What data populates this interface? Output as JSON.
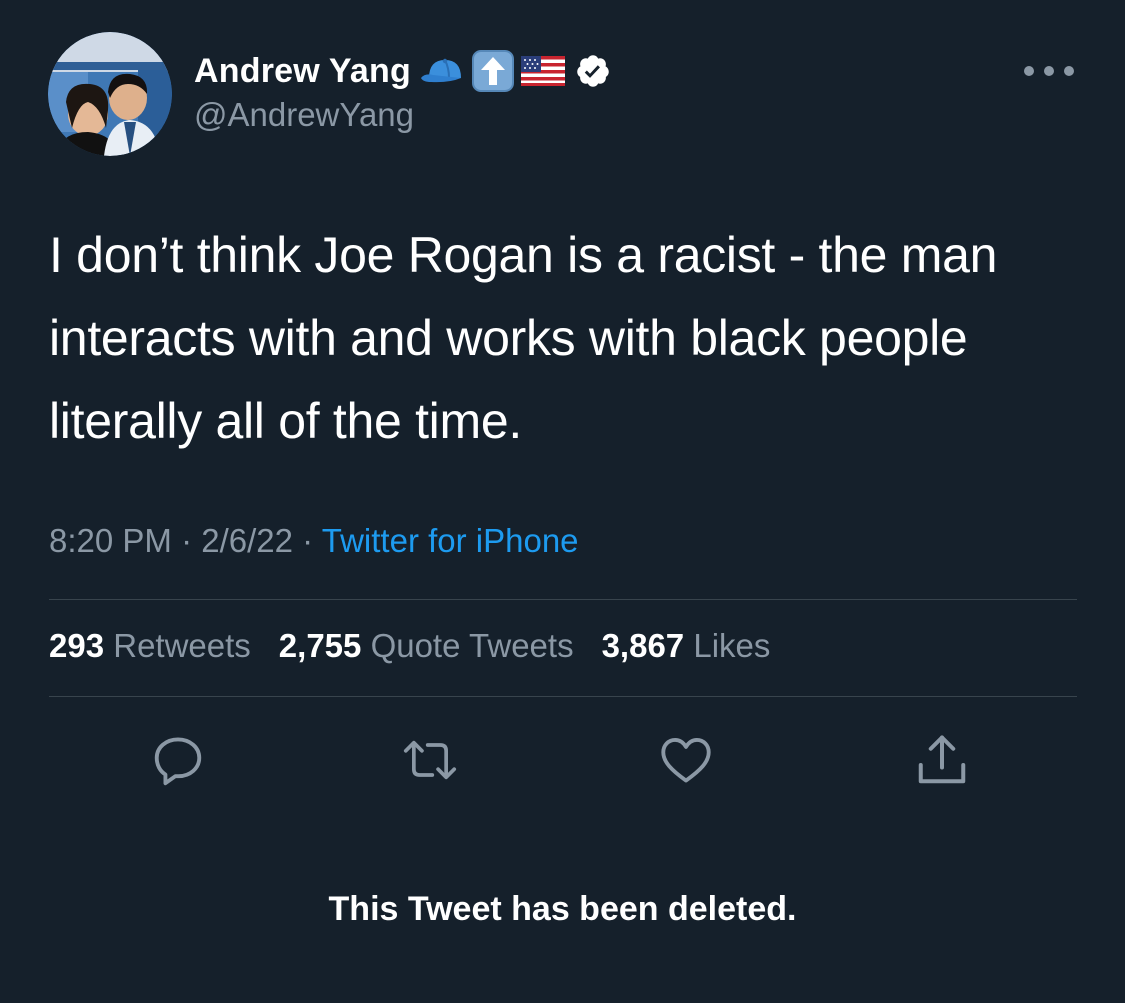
{
  "author": {
    "display_name": "Andrew Yang",
    "handle": "@AndrewYang",
    "badges": [
      "blue-cap-emoji",
      "up-arrow-emoji",
      "us-flag-emoji",
      "verified-badge-icon"
    ]
  },
  "tweet": {
    "text": "I don’t think Joe Rogan is a racist - the man interacts with and works with black people literally all of the time.",
    "time": "8:20 PM",
    "separator": "·",
    "date": "2/6/22",
    "source": "Twitter for iPhone"
  },
  "stats": {
    "retweets_count": "293",
    "retweets_label": "Retweets",
    "quotes_count": "2,755",
    "quotes_label": "Quote Tweets",
    "likes_count": "3,867",
    "likes_label": "Likes"
  },
  "actions": [
    "reply-icon",
    "retweet-icon",
    "like-icon",
    "share-icon"
  ],
  "notice": "This Tweet has been deleted.",
  "colors": {
    "background": "#15202b",
    "secondary_text": "#8b98a5",
    "link": "#1d9bf0",
    "divider": "#38444d"
  }
}
